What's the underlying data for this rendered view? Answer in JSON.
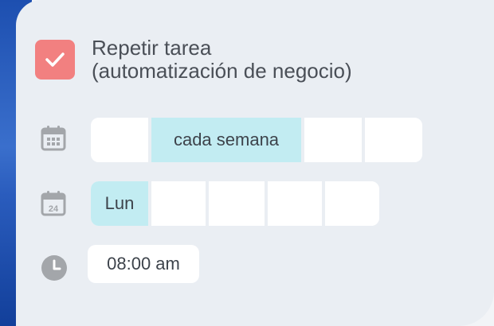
{
  "task": {
    "checked": true,
    "checkbox_color": "#f28080",
    "title_line1": "Repetir tarea",
    "title_line2": "(automatización de negocio)"
  },
  "frequency": {
    "icon": "calendar-grid-icon",
    "options": [
      "",
      "cada semana",
      "",
      ""
    ],
    "selected": "cada semana"
  },
  "weekday": {
    "icon": "calendar-day-icon",
    "icon_text": "24",
    "options": [
      "Lun",
      "",
      "",
      "",
      ""
    ],
    "selected": "Lun"
  },
  "time": {
    "icon": "clock-icon",
    "value": "08:00 am"
  },
  "colors": {
    "selected_segment": "#c2ecf2",
    "icon_gray": "#a3a6aa"
  }
}
